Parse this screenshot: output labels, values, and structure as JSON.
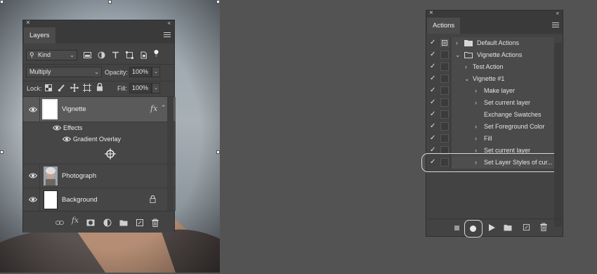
{
  "layers_panel": {
    "tab": "Layers",
    "filter_kind": "Kind",
    "blend_mode": "Multiply",
    "opacity_label": "Opacity:",
    "opacity_value": "100%",
    "lock_label": "Lock:",
    "fill_label": "Fill:",
    "fill_value": "100%",
    "layers": [
      {
        "name": "Vignette",
        "fx": "fx",
        "effects_label": "Effects",
        "effect": "Gradient Overlay"
      },
      {
        "name": "Photograph"
      },
      {
        "name": "Background"
      }
    ]
  },
  "actions_panel": {
    "tab": "Actions",
    "items": [
      {
        "label": "Default Actions"
      },
      {
        "label": "Vignette Actions"
      },
      {
        "label": "Test Action"
      },
      {
        "label": "Vignette #1"
      },
      {
        "label": "Make layer"
      },
      {
        "label": "Set current layer"
      },
      {
        "label": "Exchange Swatches"
      },
      {
        "label": "Set Foreground Color"
      },
      {
        "label": "Fill"
      },
      {
        "label": "Set current layer"
      },
      {
        "label": "Set Layer Styles of cur..."
      }
    ]
  },
  "colors": {
    "workspace": "#535353",
    "panel": "#434343",
    "highlight_ring": "#d8d8d8"
  }
}
